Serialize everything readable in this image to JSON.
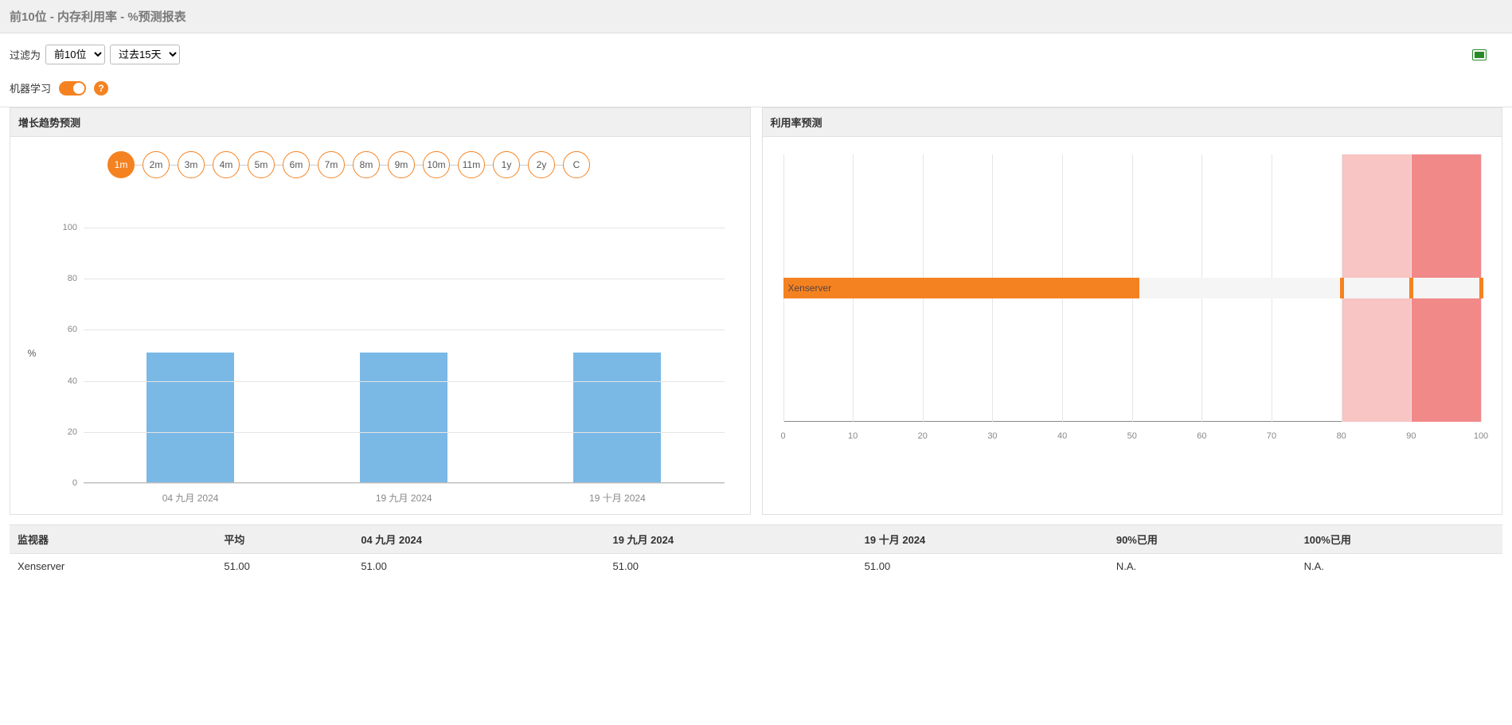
{
  "header": {
    "title": "前10位 - 内存利用率 - %预测报表"
  },
  "filters": {
    "label": "过滤为",
    "top_select_options": [
      "前10位"
    ],
    "top_select_value": "前10位",
    "period_select_options": [
      "过去15天"
    ],
    "period_select_value": "过去15天"
  },
  "ml": {
    "label": "机器学习",
    "help_glyph": "?"
  },
  "growth_panel": {
    "title": "增长趋势预测",
    "range_buttons": [
      "1m",
      "2m",
      "3m",
      "4m",
      "5m",
      "6m",
      "7m",
      "8m",
      "9m",
      "10m",
      "11m",
      "1y",
      "2y",
      "C"
    ],
    "range_active": "1m"
  },
  "util_panel": {
    "title": "利用率预测"
  },
  "chart_data": [
    {
      "type": "bar",
      "categories": [
        "04 九月 2024",
        "19 九月 2024",
        "19 十月 2024"
      ],
      "values": [
        51,
        51,
        51
      ],
      "ylabel": "%",
      "ylim": [
        0,
        110
      ],
      "yticks": [
        0,
        20,
        40,
        60,
        80,
        100
      ]
    },
    {
      "type": "bar-horizontal",
      "series_label": "Xenserver",
      "value": 51,
      "marks": [
        80,
        90,
        100
      ],
      "regions": [
        {
          "from": 80,
          "to": 90,
          "style": "pink"
        },
        {
          "from": 90,
          "to": 100,
          "style": "red"
        }
      ],
      "xlim": [
        0,
        100
      ],
      "xticks": [
        0,
        10,
        20,
        30,
        40,
        50,
        60,
        70,
        80,
        90,
        100
      ]
    }
  ],
  "table": {
    "headers": [
      "监视器",
      "平均",
      "04 九月 2024",
      "19 九月 2024",
      "19 十月 2024",
      "90%已用",
      "100%已用"
    ],
    "rows": [
      [
        "Xenserver",
        "51.00",
        "51.00",
        "51.00",
        "51.00",
        "N.A.",
        "N.A."
      ]
    ]
  }
}
